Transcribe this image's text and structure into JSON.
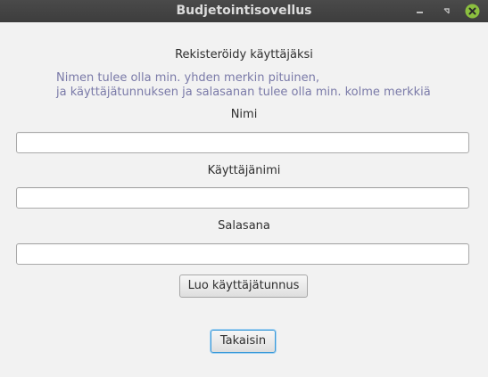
{
  "window": {
    "title": "Budjetointisovellus",
    "controls": [
      "minimize-icon",
      "maximize-icon",
      "close-icon"
    ],
    "accent_close": "#8bbf3f"
  },
  "form": {
    "heading": "Rekisteröidy käyttäjäksi",
    "hint_line1": "Nimen tulee olla min. yhden merkin pituinen,",
    "hint_line2": "ja käyttäjätunnuksen ja salasanan tulee olla min. kolme merkkiä",
    "name_label": "Nimi",
    "name_value": "",
    "username_label": "Käyttäjänimi",
    "username_value": "",
    "password_label": "Salasana",
    "password_value": "",
    "create_button": "Luo käyttäjätunnus",
    "back_button": "Takaisin"
  }
}
